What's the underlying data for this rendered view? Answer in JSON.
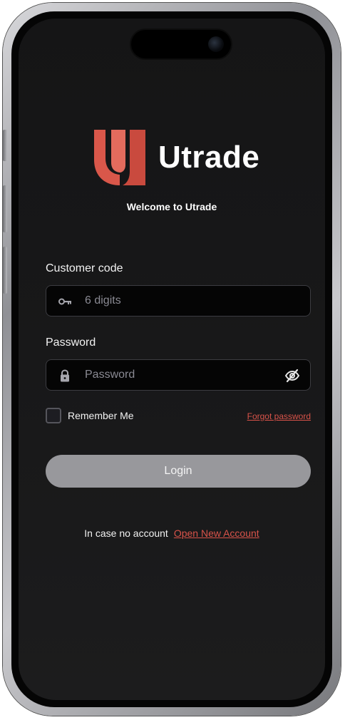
{
  "brand": {
    "name": "Utrade",
    "accent_color": "#d9574a"
  },
  "welcome": "Welcome to Utrade",
  "customer_code": {
    "label": "Customer code",
    "placeholder": "6 digits",
    "value": "",
    "icon": "key-icon"
  },
  "password": {
    "label": "Password",
    "placeholder": "Password",
    "value": "",
    "icon": "lock-icon",
    "toggle_icon": "eye-off-icon"
  },
  "remember": {
    "label": "Remember Me",
    "checked": false
  },
  "forgot_password": "Forgot password",
  "login_button": "Login",
  "signup": {
    "prompt": "In case no account",
    "link": "Open New Account"
  }
}
